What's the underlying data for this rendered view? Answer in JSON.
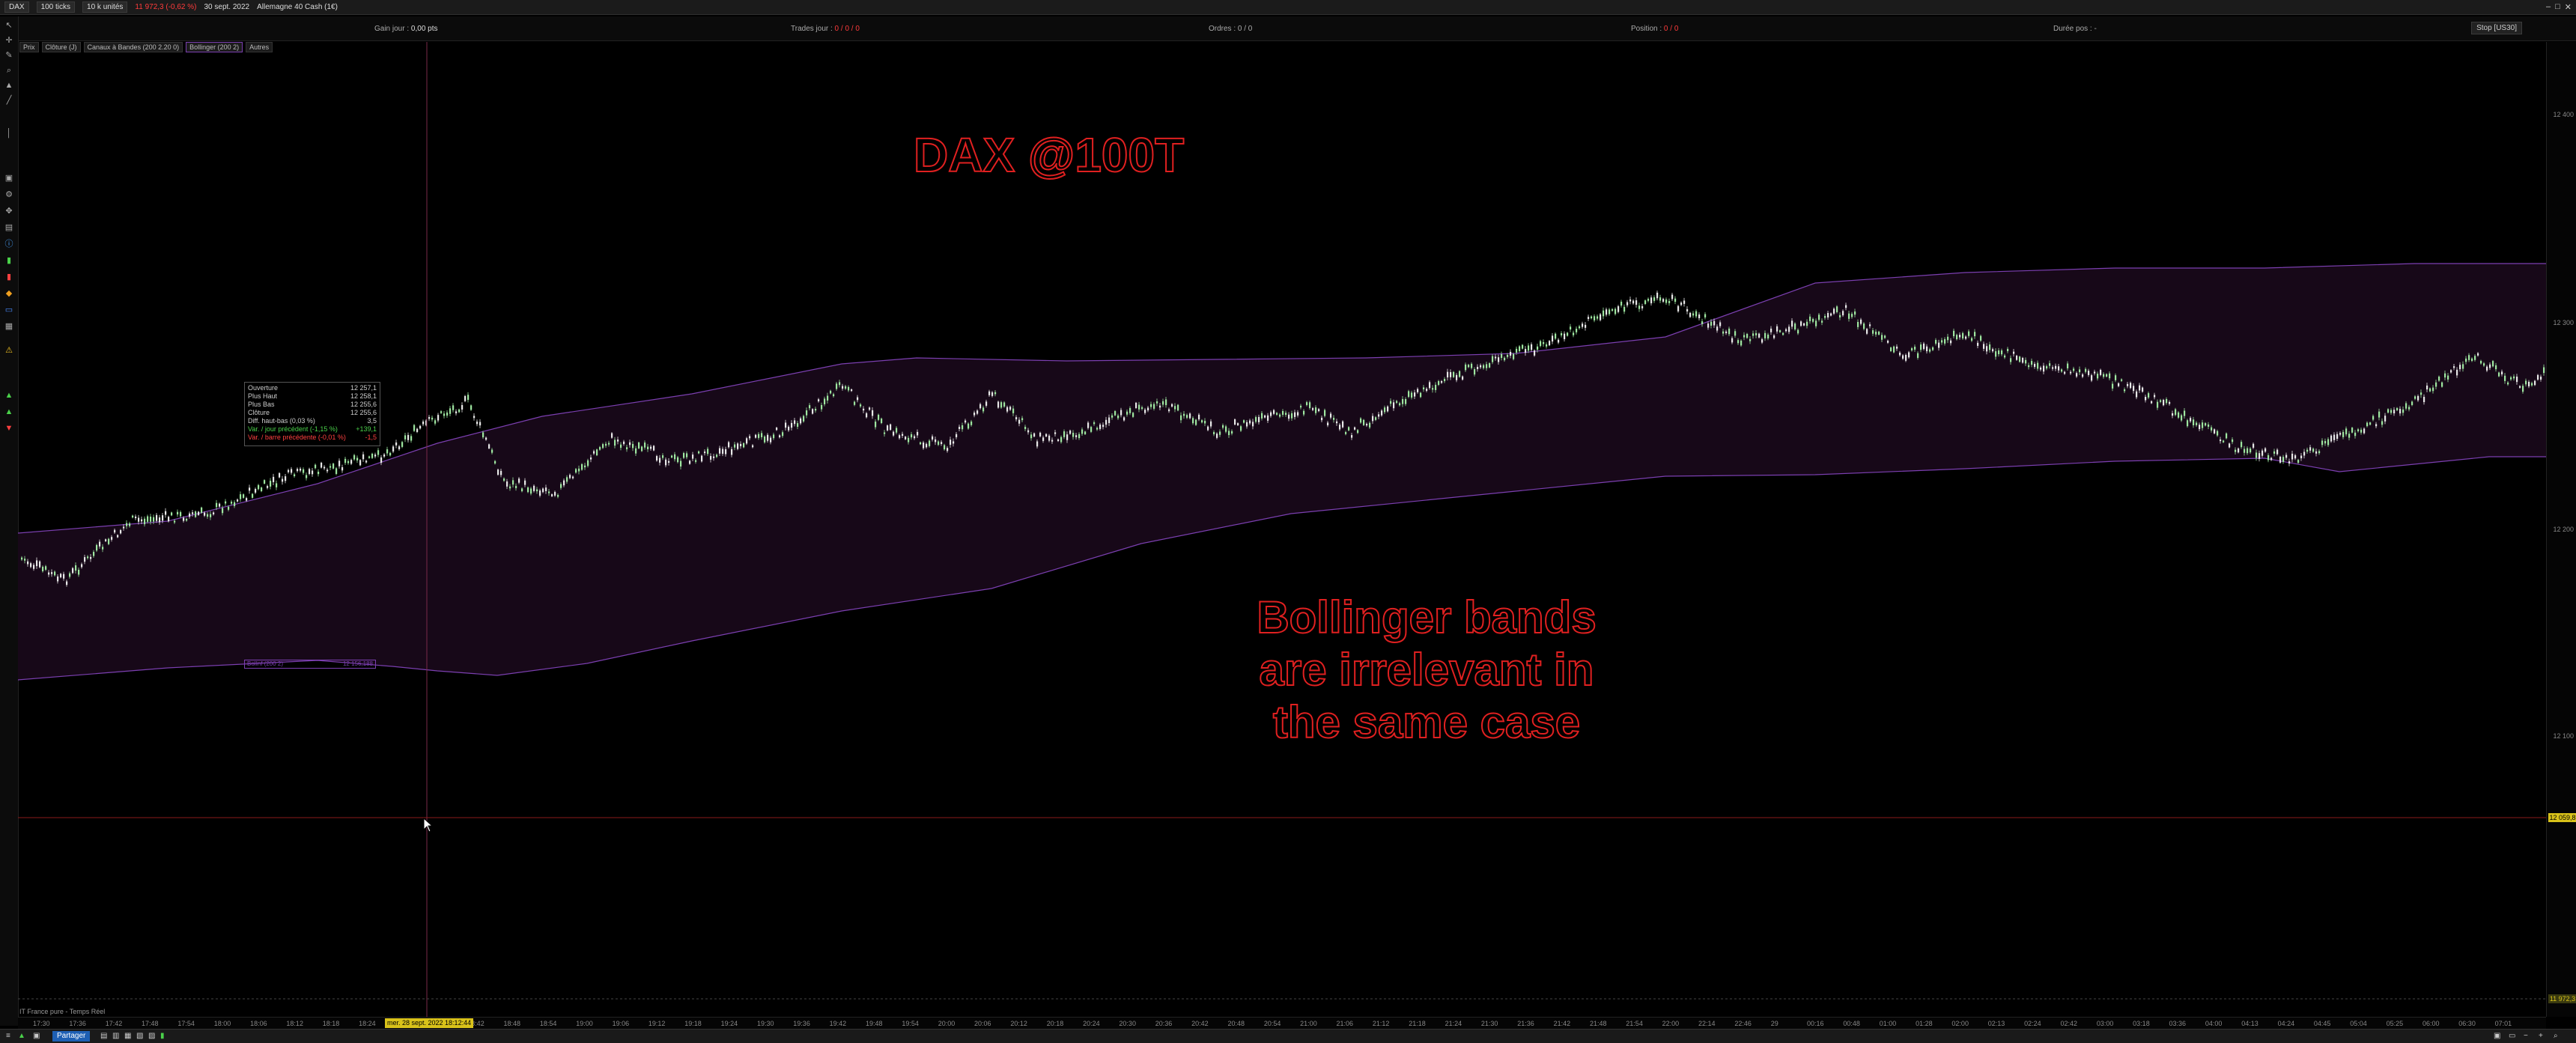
{
  "topbar": {
    "instrument": "DAX",
    "timeframe": "100 ticks",
    "units": "10 k unités",
    "price_change": "11 972,3 (-0,62 %)",
    "date": "30 sept. 2022",
    "market": "Allemagne 40 Cash (1€)"
  },
  "stats": {
    "gain_label": "Gain jour :",
    "gain_value": "0,00 pts",
    "trades_label": "Trades jour :",
    "trades_value": "0 / 0 / 0",
    "orders_label": "Ordres :",
    "orders_value": "0 / 0",
    "position_label": "Position :",
    "position_value": "0 / 0",
    "duration_label": "Durée pos :",
    "duration_value": "-",
    "stop_button": "Stop [US30]"
  },
  "legend": {
    "items": [
      "Prix",
      "Clôture (J)",
      "Canaux à Bandes (200 2.20 0)",
      "Bollinger (200 2)",
      "Autres"
    ]
  },
  "infobox": {
    "rows": [
      {
        "label": "Ouverture",
        "value": "12 257,1"
      },
      {
        "label": "Plus Haut",
        "value": "12 258,1"
      },
      {
        "label": "Plus Bas",
        "value": "12 255,6"
      },
      {
        "label": "Clôture",
        "value": "12 255,6"
      },
      {
        "label": "Diff. haut-bas (0,03 %)",
        "value": "3,5"
      },
      {
        "label": "Var. / jour précédent (-1,15 %)",
        "value": "+139,1"
      },
      {
        "label": "Var. / barre précédente (-0,01 %)",
        "value": "-1,5"
      }
    ],
    "bb_label": "BolInf (200 2)",
    "bb_value": "12 156,188"
  },
  "annotations": {
    "title": "DAX @100T",
    "line1": "Bollinger bands",
    "line2": "are irrelevant in",
    "line3": "the same case"
  },
  "price_axis": {
    "ticks": [
      "12 400",
      "12 300",
      "12 200",
      "12 100"
    ],
    "cursor_badge": "12 059,8",
    "bottom_badge": "11 972,3"
  },
  "time_axis": {
    "ticks": [
      "17:30",
      "17:36",
      "17:42",
      "17:48",
      "17:54",
      "18:00",
      "18:06",
      "18:12",
      "18:18",
      "18:24",
      "18:30",
      "18:36",
      "18:42",
      "18:48",
      "18:54",
      "19:00",
      "19:06",
      "19:12",
      "19:18",
      "19:24",
      "19:30",
      "19:36",
      "19:42",
      "19:48",
      "19:54",
      "20:00",
      "20:06",
      "20:12",
      "20:18",
      "20:24",
      "20:30",
      "20:36",
      "20:42",
      "20:48",
      "20:54",
      "21:00",
      "21:06",
      "21:12",
      "21:18",
      "21:24",
      "21:30",
      "21:36",
      "21:42",
      "21:48",
      "21:54",
      "22:00",
      "22:14",
      "22:46",
      "29",
      "00:16",
      "00:48",
      "01:00",
      "01:28",
      "02:00",
      "02:13",
      "02:24",
      "02:42",
      "03:00",
      "03:18",
      "03:36",
      "04:00",
      "04:13",
      "04:24",
      "04:45",
      "05:04",
      "05:25",
      "06:00",
      "06:30",
      "07:01"
    ],
    "cursor_time": "mer. 28 sept. 2022 18:12:44"
  },
  "pane": {
    "label": "IT France pure - Temps Réel"
  },
  "taskbar": {
    "share_label": "Partager"
  },
  "colors": {
    "band_fill": "#170818",
    "band_line": "#7b3fb0",
    "candle_up": "#9ee6a0",
    "candle_down": "#e8e8e8",
    "annotation": "#e02020",
    "crosshair_v": "#7a2a4a",
    "crosshair_h": "#8a1a1a"
  }
}
